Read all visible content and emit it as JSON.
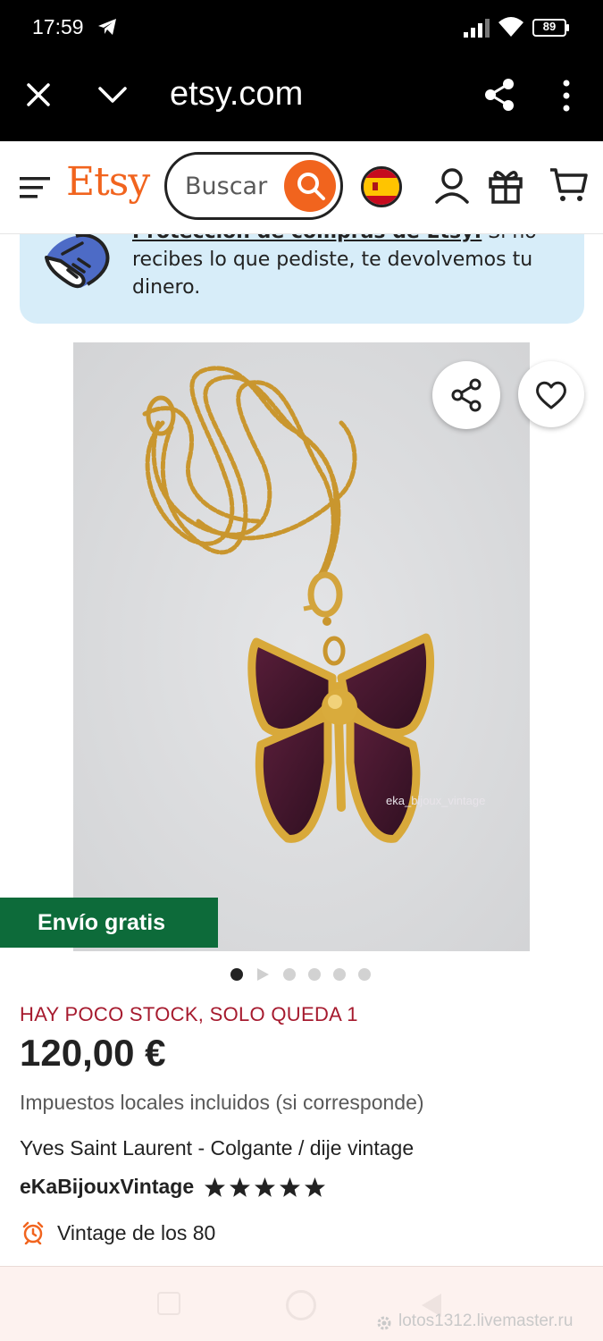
{
  "status_bar": {
    "time": "17:59",
    "battery": "89",
    "icons": [
      "telegram-icon",
      "signal-icon",
      "wifi-icon",
      "battery-icon"
    ]
  },
  "browser": {
    "url": "etsy.com",
    "icons": [
      "close-icon",
      "chevron-down-icon",
      "share-icon",
      "more-icon"
    ]
  },
  "header": {
    "logo": "Etsy",
    "search_placeholder": "Buscar",
    "icons": [
      "menu-icon",
      "search-icon",
      "flag-icon",
      "user-icon",
      "gift-icon",
      "cart-icon"
    ]
  },
  "protection_banner": {
    "link_text": "Protección de compras de Etsy:",
    "text": " Si no recibes lo que pediste, te devolvemos tu dinero."
  },
  "product": {
    "image_watermark": "eka_bijoux_vintage",
    "badge": "Envío gratis",
    "carousel_count": 6,
    "carousel_active": 1,
    "stock": "HAY POCO STOCK, SOLO QUEDA 1",
    "price": "120,00 €",
    "tax": "Impuestos locales incluidos (si corresponde)",
    "title": "Yves Saint Laurent - Colgante / dije vintage",
    "shop": "eKaBijouxVintage",
    "rating": 5,
    "rating_max": 5,
    "era": "Vintage de los 80"
  },
  "watermark": {
    "site": "lotos1312.livemaster.ru"
  },
  "colors": {
    "etsy_orange": "#f1641e",
    "free_shipping_green": "#0d6b3a",
    "stock_red": "#a61a2e",
    "banner_blue": "#d7edf9"
  }
}
